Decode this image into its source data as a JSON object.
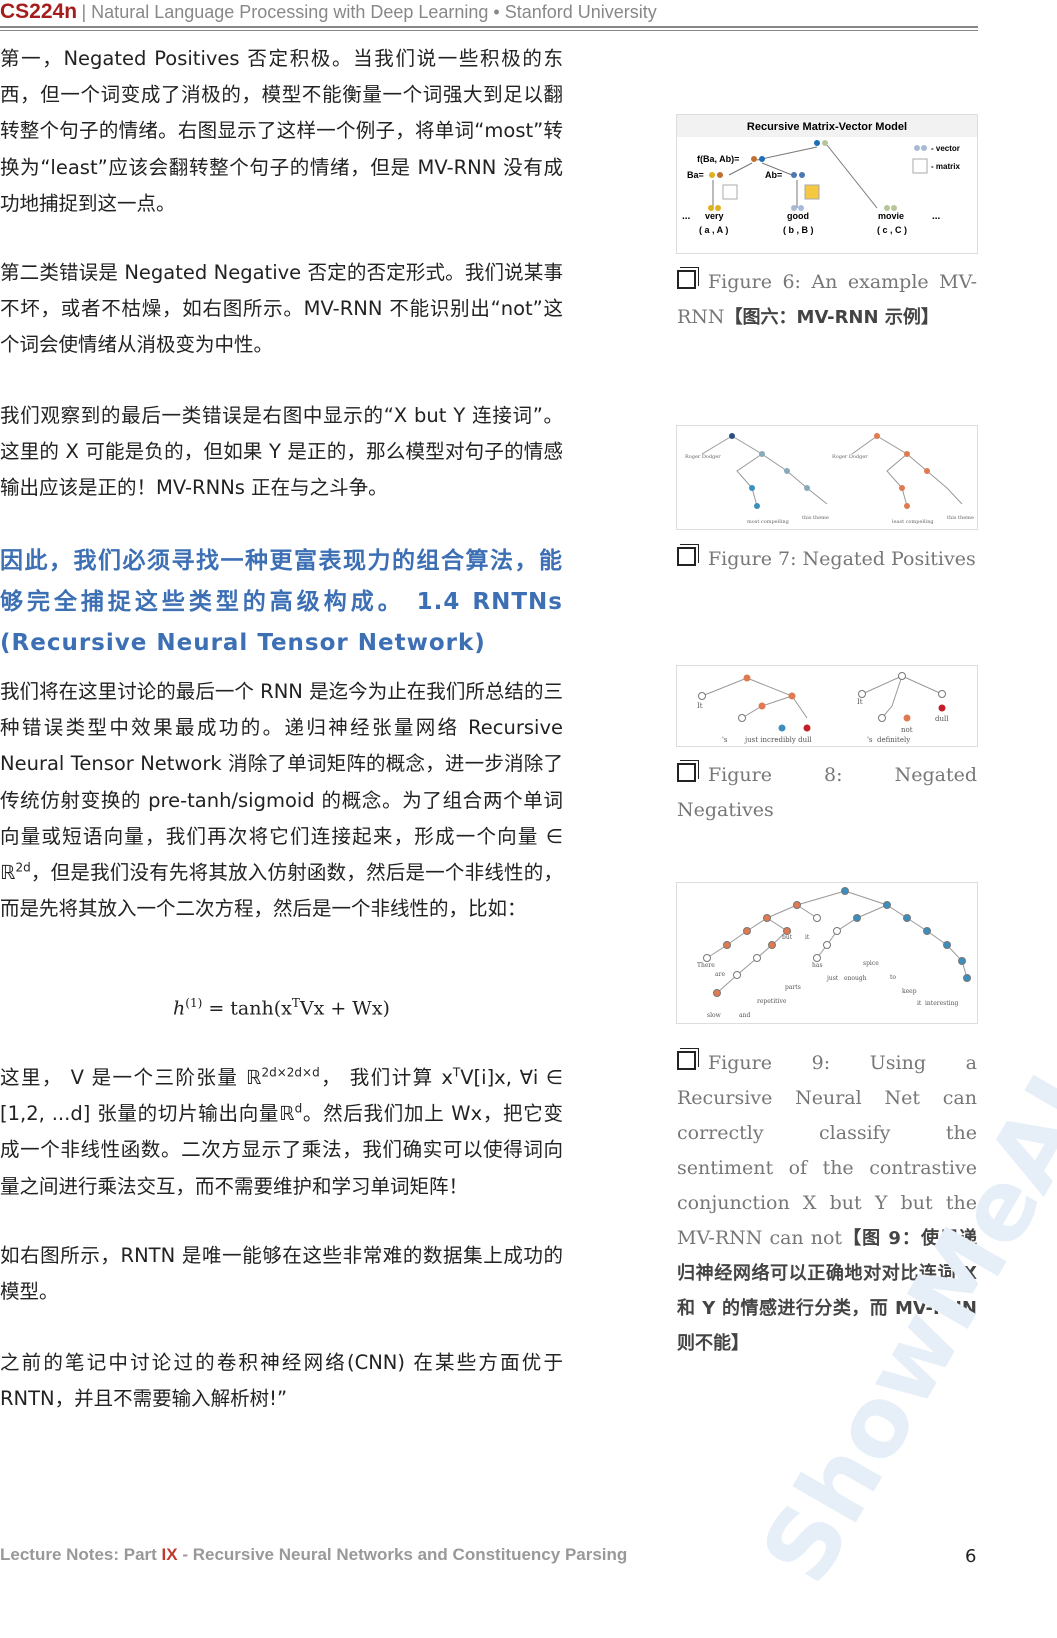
{
  "header": {
    "course_code": "CS224n",
    "subtitle": "| Natural Language Processing with Deep Learning • Stanford University"
  },
  "body": {
    "p1": "第一，Negated Positives 否定积极。当我们说一些积极的东西，但一个词变成了消极的，模型不能衡量一个词强大到足以翻转整个句子的情绪。右图显示了这样一个例子，将单词“most”转换为“least”应该会翻转整个句子的情绪，但是 MV-RNN 没有成功地捕捉到这一点。",
    "p2": "第二类错误是 Negated Negative 否定的否定形式。我们说某事不坏，或者不枯燥，如右图所示。MV-RNN 不能识别出“not”这个词会使情绪从消极变为中性。",
    "p3": "我们观察到的最后一类错误是右图中显示的“X but Y 连接词”。这里的 X 可能是负的，但如果 Y 是正的，那么模型对句子的情感输出应该是正的！MV-RNNs 正在与之斗争。",
    "heading": "因此，我们必须寻找一种更富表现力的组合算法，能够完全捕捉这些类型的高级构成。 1.4 RNTNs (Recursive Neural Tensor Network)",
    "p4_a": "我们将在这里讨论的最后一个 RNN 是迄今为止在我们所总结的三种错误类型中效果最成功的。递归神经张量网络 Recursive Neural Tensor Network 消除了单词矩阵的概念，进一步消除了传统仿射变换的 pre-tanh/sigmoid 的概念。为了组合两个单词向量或短语向量，我们再次将它们连接起来，形成一个向量 ∈ ℝ",
    "p4_sup": "2d",
    "p4_b": "，但是我们没有先将其放入仿射函数，然后是一个非线性的，而是先将其放入一个二次方程，然后是一个非线性的，比如：",
    "formula": {
      "lhs": "h",
      "lhs_sup": "(1)",
      "mid": " = tanh(x",
      "mid_sup": "T",
      "rhs": "Vx + Wx)"
    },
    "p5_a": "这里， V 是一个三阶张量 ℝ",
    "p5_sup1": "2d×2d×d",
    "p5_b": "， 我们计算 x",
    "p5_sup2": "T",
    "p5_c": "V[i]x, ∀i ∈ [1,2, ...d] 张量的切片输出向量ℝ",
    "p5_sup3": "d",
    "p5_d": "。然后我们加上 Wx，把它变成一个非线性函数。二次方显示了乘法，我们确实可以使得词向量之间进行乘法交互，而不需要维护和学习单词矩阵！",
    "p6": "如右图所示，RNTN 是唯一能够在这些非常难的数据集上成功的模型。",
    "p7": "之前的笔记中讨论过的卷积神经网络(CNN) 在某些方面优于 RNTN，并且不需要输入解析树!”"
  },
  "figures": {
    "fig6": {
      "title": "Recursive Matrix-Vector Model",
      "legend_vector": "- vector",
      "legend_matrix": "- matrix",
      "f_label": "f(Ba, Ab)=",
      "ba_label": "Ba=",
      "ab_label": "Ab=",
      "words": [
        "very",
        "good",
        "movie"
      ],
      "pairs": [
        "( a , A )",
        "( b , B )",
        "( c , C )"
      ],
      "ellipsis": "...",
      "caption": "Figure 6: An example MV-RNN",
      "caption_cn": "【图六：MV-RNN 示例】"
    },
    "fig7": {
      "caption": "Figure 7: Negated Positives",
      "words": [
        "Roger Dodger",
        "is",
        "one",
        "of",
        "the",
        "most compelling",
        "variations",
        "this theme",
        "least compelling"
      ]
    },
    "fig8": {
      "caption": "Figure 8: Negated Negatives",
      "words": [
        "It",
        "'s",
        "just incredibly dull",
        "It",
        "'s",
        "definitely",
        "not",
        "dull"
      ]
    },
    "fig9": {
      "words": [
        "There",
        "are",
        "slow",
        "and",
        "repetitive",
        "parts",
        "but",
        "it",
        "has",
        "just",
        "enough",
        "spice",
        "to",
        "keep",
        "it",
        "interesting"
      ],
      "caption": "Figure 9: Using a Recursive Neural Net can correctly classify the sentiment of the contrastive conjunction X but Y but the MV-RNN can not",
      "caption_cn": "【图 9：使用递归神经网络可以正确地对对比连词 X 和 Y 的情感进行分类，而 MV-RNN 则不能】"
    }
  },
  "footer": {
    "prefix": "Lecture Notes: Part ",
    "part": "IX",
    "suffix": " - Recursive Neural Networks and Constituency Parsing",
    "page": "6"
  },
  "watermark": "ShowMeAI",
  "colors": {
    "brand_red": "#a51c1c",
    "heading_blue": "#3c6fb4"
  }
}
